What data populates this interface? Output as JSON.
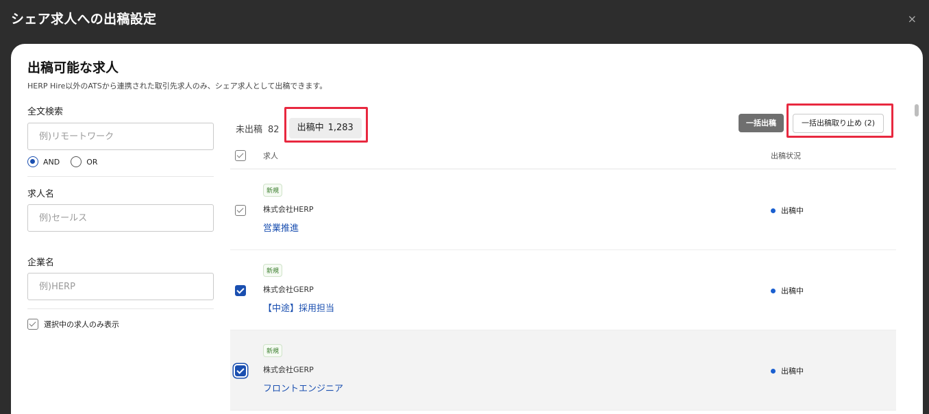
{
  "window": {
    "title": "シェア求人への出稿設定",
    "close_label": "×"
  },
  "sheet": {
    "title": "出稿可能な求人",
    "description": "HERP Hire以外のATSから連携された取引先求人のみ、シェア求人として出稿できます。"
  },
  "filters": {
    "fulltext": {
      "label": "全文検索",
      "placeholder": "例)リモートワーク",
      "value": ""
    },
    "match_mode": {
      "options": [
        "AND",
        "OR"
      ],
      "selected": "AND"
    },
    "job_name": {
      "label": "求人名",
      "placeholder": "例)セールス",
      "value": ""
    },
    "company": {
      "label": "企業名",
      "placeholder": "例)HERP",
      "value": ""
    },
    "only_selected": {
      "label": "選択中の求人のみ表示",
      "checked": true
    }
  },
  "tabs": {
    "unpublished": {
      "label": "未出稿",
      "count": "82"
    },
    "published": {
      "label": "出稿中",
      "count": "1,283",
      "active": true
    }
  },
  "actions": {
    "bulk_publish": "一括出稿",
    "bulk_unpublish": "一括出稿取り止め (2)"
  },
  "table": {
    "headers": {
      "job": "求人",
      "status": "出稿状況"
    },
    "rows": [
      {
        "badge": "新規",
        "company": "株式会社HERP",
        "title": "営業推進",
        "status": "出稿中",
        "checked": false
      },
      {
        "badge": "新規",
        "company": "株式会社GERP",
        "title": "【中途】採用担当",
        "status": "出稿中",
        "checked": true
      },
      {
        "badge": "新規",
        "company": "株式会社GERP",
        "title": "フロントエンジニア",
        "status": "出稿中",
        "checked": true
      }
    ]
  },
  "colors": {
    "accent": "#1a4fb0",
    "highlight": "#e8283f",
    "badge_green": "#3a7d2c",
    "status_dot": "#1a5fd0"
  }
}
